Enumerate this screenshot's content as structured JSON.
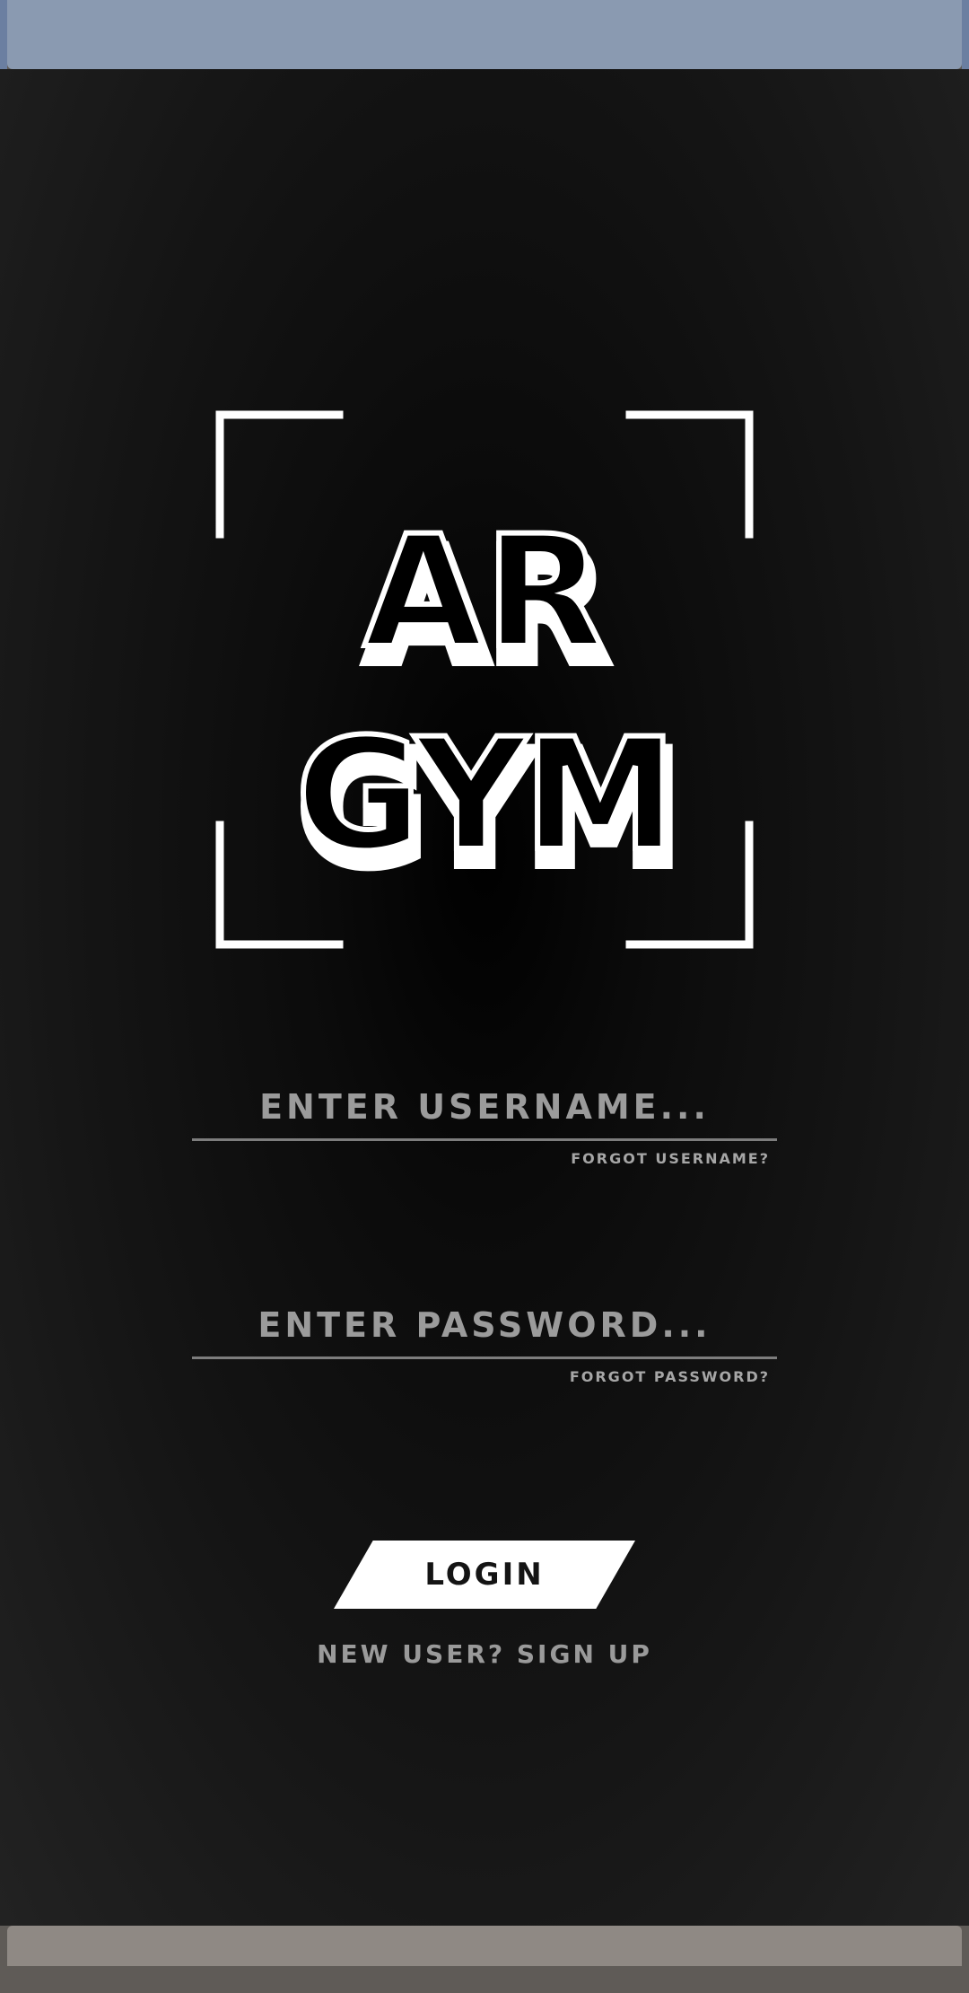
{
  "logo": {
    "line1": "AR",
    "line2": "GYM"
  },
  "username": {
    "placeholder": "ENTER USERNAME...",
    "value": "",
    "forgot_label": "FORGOT USERNAME?"
  },
  "password": {
    "placeholder": "ENTER PASSWORD...",
    "value": "",
    "forgot_label": "FORGOT PASSWORD?"
  },
  "login_label": "LOGIN",
  "signup_label": "NEW USER? SIGN UP",
  "colors": {
    "background": "#111111",
    "status_bar": "#8a9ab1",
    "nav_bar": "#8f8984",
    "field_text": "#9b9b9b",
    "button_bg": "#ffffff",
    "button_text": "#141414"
  },
  "icons": [
    "scan-frame-icon"
  ]
}
